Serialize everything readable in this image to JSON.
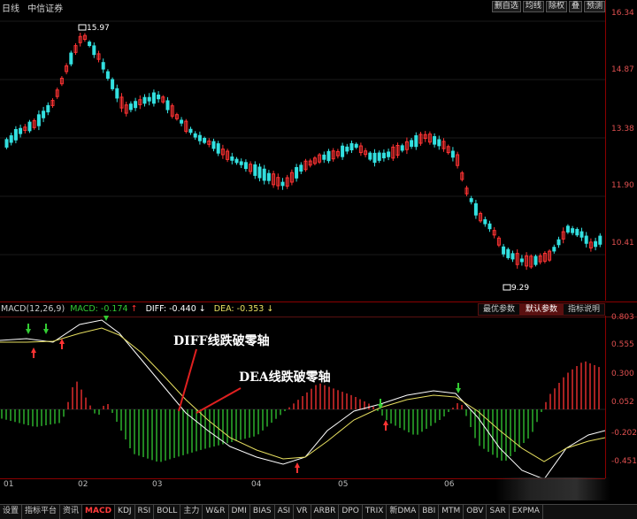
{
  "topbar": {
    "period": "日线",
    "stock_name": "中信证券",
    "buttons": [
      "删自选",
      "均线",
      "除权",
      "叠",
      "预测"
    ]
  },
  "price_axis": {
    "labels": [
      "16.34",
      "14.87",
      "13.38",
      "11.90",
      "10.41"
    ]
  },
  "price_markers": {
    "high": "15.97",
    "low": "9.29"
  },
  "indicator": {
    "name": "MACD(12,26,9)",
    "macd_label": "MACD:",
    "macd_value": "-0.174",
    "diff_label": "DIFF:",
    "diff_value": "-0.440",
    "dea_label": "DEA:",
    "dea_value": "-0.353",
    "tabs": [
      "最优参数",
      "默认参数",
      "指标说明"
    ],
    "axis_labels": [
      "0.803",
      "0.555",
      "0.300",
      "0.052",
      "-0.202",
      "-0.451"
    ]
  },
  "annotations": {
    "diff": "DIFF线跌破零轴",
    "dea": "DEA线跌破零轴"
  },
  "dates": [
    "01",
    "02",
    "03",
    "04",
    "05",
    "06"
  ],
  "bottom_tabs": [
    "设置",
    "指标平台",
    "资讯",
    "MACD",
    "KDJ",
    "RSI",
    "BOLL",
    "主力",
    "W&R",
    "DMI",
    "BIAS",
    "ASI",
    "VR",
    "ARBR",
    "DPO",
    "TRIX",
    "新DMA",
    "BBI",
    "MTM",
    "OBV",
    "SAR",
    "EXPMA"
  ],
  "active_tab": "MACD",
  "colors": {
    "up": "#ff3333",
    "down": "#33e0e0",
    "diff": "#ffffff",
    "dea": "#e8e060",
    "hist_pos": "#ff3333",
    "hist_neg": "#33cc33",
    "axis": "#8b0000"
  }
}
